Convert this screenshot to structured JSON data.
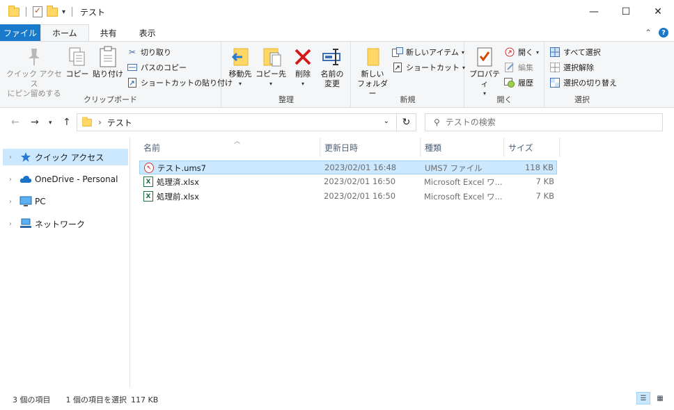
{
  "window": {
    "title": "テスト",
    "minimize_glyph": "—",
    "maximize_glyph": "☐",
    "close_glyph": "✕"
  },
  "ribbon_tabs": {
    "file": "ファイル",
    "home": "ホーム",
    "share": "共有",
    "view": "表示"
  },
  "ribbon": {
    "clipboard": {
      "label": "クリップボード",
      "pin_quick_access": "クイック アクセス\nにピン留めする",
      "copy": "コピー",
      "paste": "貼り付け",
      "cut": "切り取り",
      "copy_path": "パスのコピー",
      "paste_shortcut": "ショートカットの貼り付け"
    },
    "organize": {
      "label": "整理",
      "move_to": "移動先",
      "copy_to": "コピー先",
      "delete": "削除",
      "rename": "名前の\n変更"
    },
    "new": {
      "label": "新規",
      "new_folder": "新しい\nフォルダー",
      "new_item": "新しいアイテム",
      "shortcut": "ショートカット"
    },
    "open": {
      "label": "開く",
      "properties": "プロパティ",
      "open": "開く",
      "edit": "編集",
      "history": "履歴"
    },
    "select": {
      "label": "選択",
      "select_all": "すべて選択",
      "select_none": "選択解除",
      "invert": "選択の切り替え"
    }
  },
  "address": {
    "path": "テスト",
    "separator": "›"
  },
  "search": {
    "placeholder": "テストの検索"
  },
  "nav_pane": {
    "items": [
      {
        "label": "クイック アクセス",
        "icon": "star-icon"
      },
      {
        "label": "OneDrive - Personal",
        "icon": "cloud-icon"
      },
      {
        "label": "PC",
        "icon": "monitor-icon"
      },
      {
        "label": "ネットワーク",
        "icon": "network-icon"
      }
    ]
  },
  "file_list": {
    "columns": [
      "名前",
      "更新日時",
      "種類",
      "サイズ"
    ],
    "rows": [
      {
        "name": "テスト.ums7",
        "modified": "2023/02/01 16:48",
        "type": "UMS7 ファイル",
        "size": "118 KB"
      },
      {
        "name": "処理済.xlsx",
        "modified": "2023/02/01 16:50",
        "type": "Microsoft Excel ワ...",
        "size": "7 KB"
      },
      {
        "name": "処理前.xlsx",
        "modified": "2023/02/01 16:50",
        "type": "Microsoft Excel ワ...",
        "size": "7 KB"
      }
    ]
  },
  "status": {
    "item_count": "3 個の項目",
    "selected": "1 個の項目を選択",
    "selected_size": "117 KB"
  },
  "colors": {
    "accent": "#1979ca",
    "selection": "#cce8ff",
    "folder": "#ffd766"
  }
}
